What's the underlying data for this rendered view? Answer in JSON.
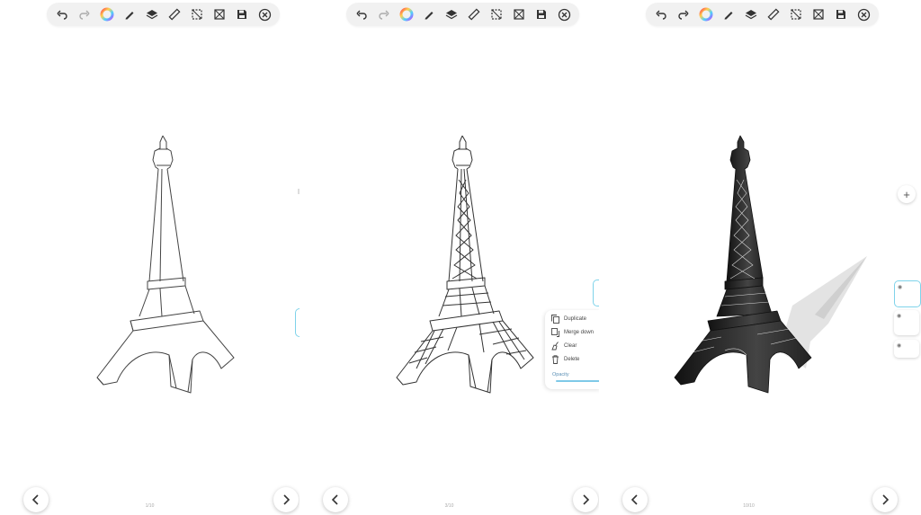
{
  "screens": [
    {
      "page_indicator": "1/10"
    },
    {
      "page_indicator": "3/10"
    },
    {
      "page_indicator": "10/10"
    }
  ],
  "toolbar": {
    "icons": [
      "undo-icon",
      "redo-icon",
      "color-wheel-icon",
      "pencil-icon",
      "layers-icon",
      "ruler-icon",
      "selection-icon",
      "transform-icon",
      "save-icon",
      "close-icon"
    ]
  },
  "layer_menu": {
    "items": [
      {
        "label": "Duplicate",
        "icon": "duplicate-icon"
      },
      {
        "label": "Merge down",
        "icon": "merge-down-icon"
      },
      {
        "label": "Clear",
        "icon": "clear-icon"
      },
      {
        "label": "Delete",
        "icon": "delete-icon"
      }
    ],
    "opacity_label": "Opacity"
  },
  "layers_panel": {
    "add_label": "+"
  },
  "colors": {
    "accent": "#7fd3ea",
    "toolbar_bg": "#f1f1f1",
    "ink": "#222222"
  }
}
